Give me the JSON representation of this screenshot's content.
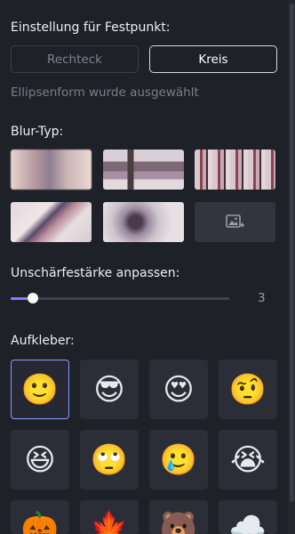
{
  "fixpoint": {
    "title": "Einstellung für Festpunkt:",
    "options": [
      "Rechteck",
      "Kreis"
    ],
    "selected": "Kreis",
    "hint": "Ellipsenform wurde ausgewählt"
  },
  "blur_type": {
    "title": "Blur-Typ:",
    "add_icon": "add-image-icon"
  },
  "strength": {
    "title": "Unschärfestärke anpassen:",
    "value": "3",
    "fraction": 0.1
  },
  "stickers": {
    "title": "Aufkleber:",
    "items": [
      "🙂",
      "😎",
      "😍",
      "🤨",
      "😆",
      "🙄",
      "🥲",
      "😭",
      "🎃",
      "🍁",
      "🐻",
      "☁️"
    ],
    "selected_index": 0
  },
  "colors": {
    "accent": "#8b7bff",
    "background": "#1f2129"
  }
}
